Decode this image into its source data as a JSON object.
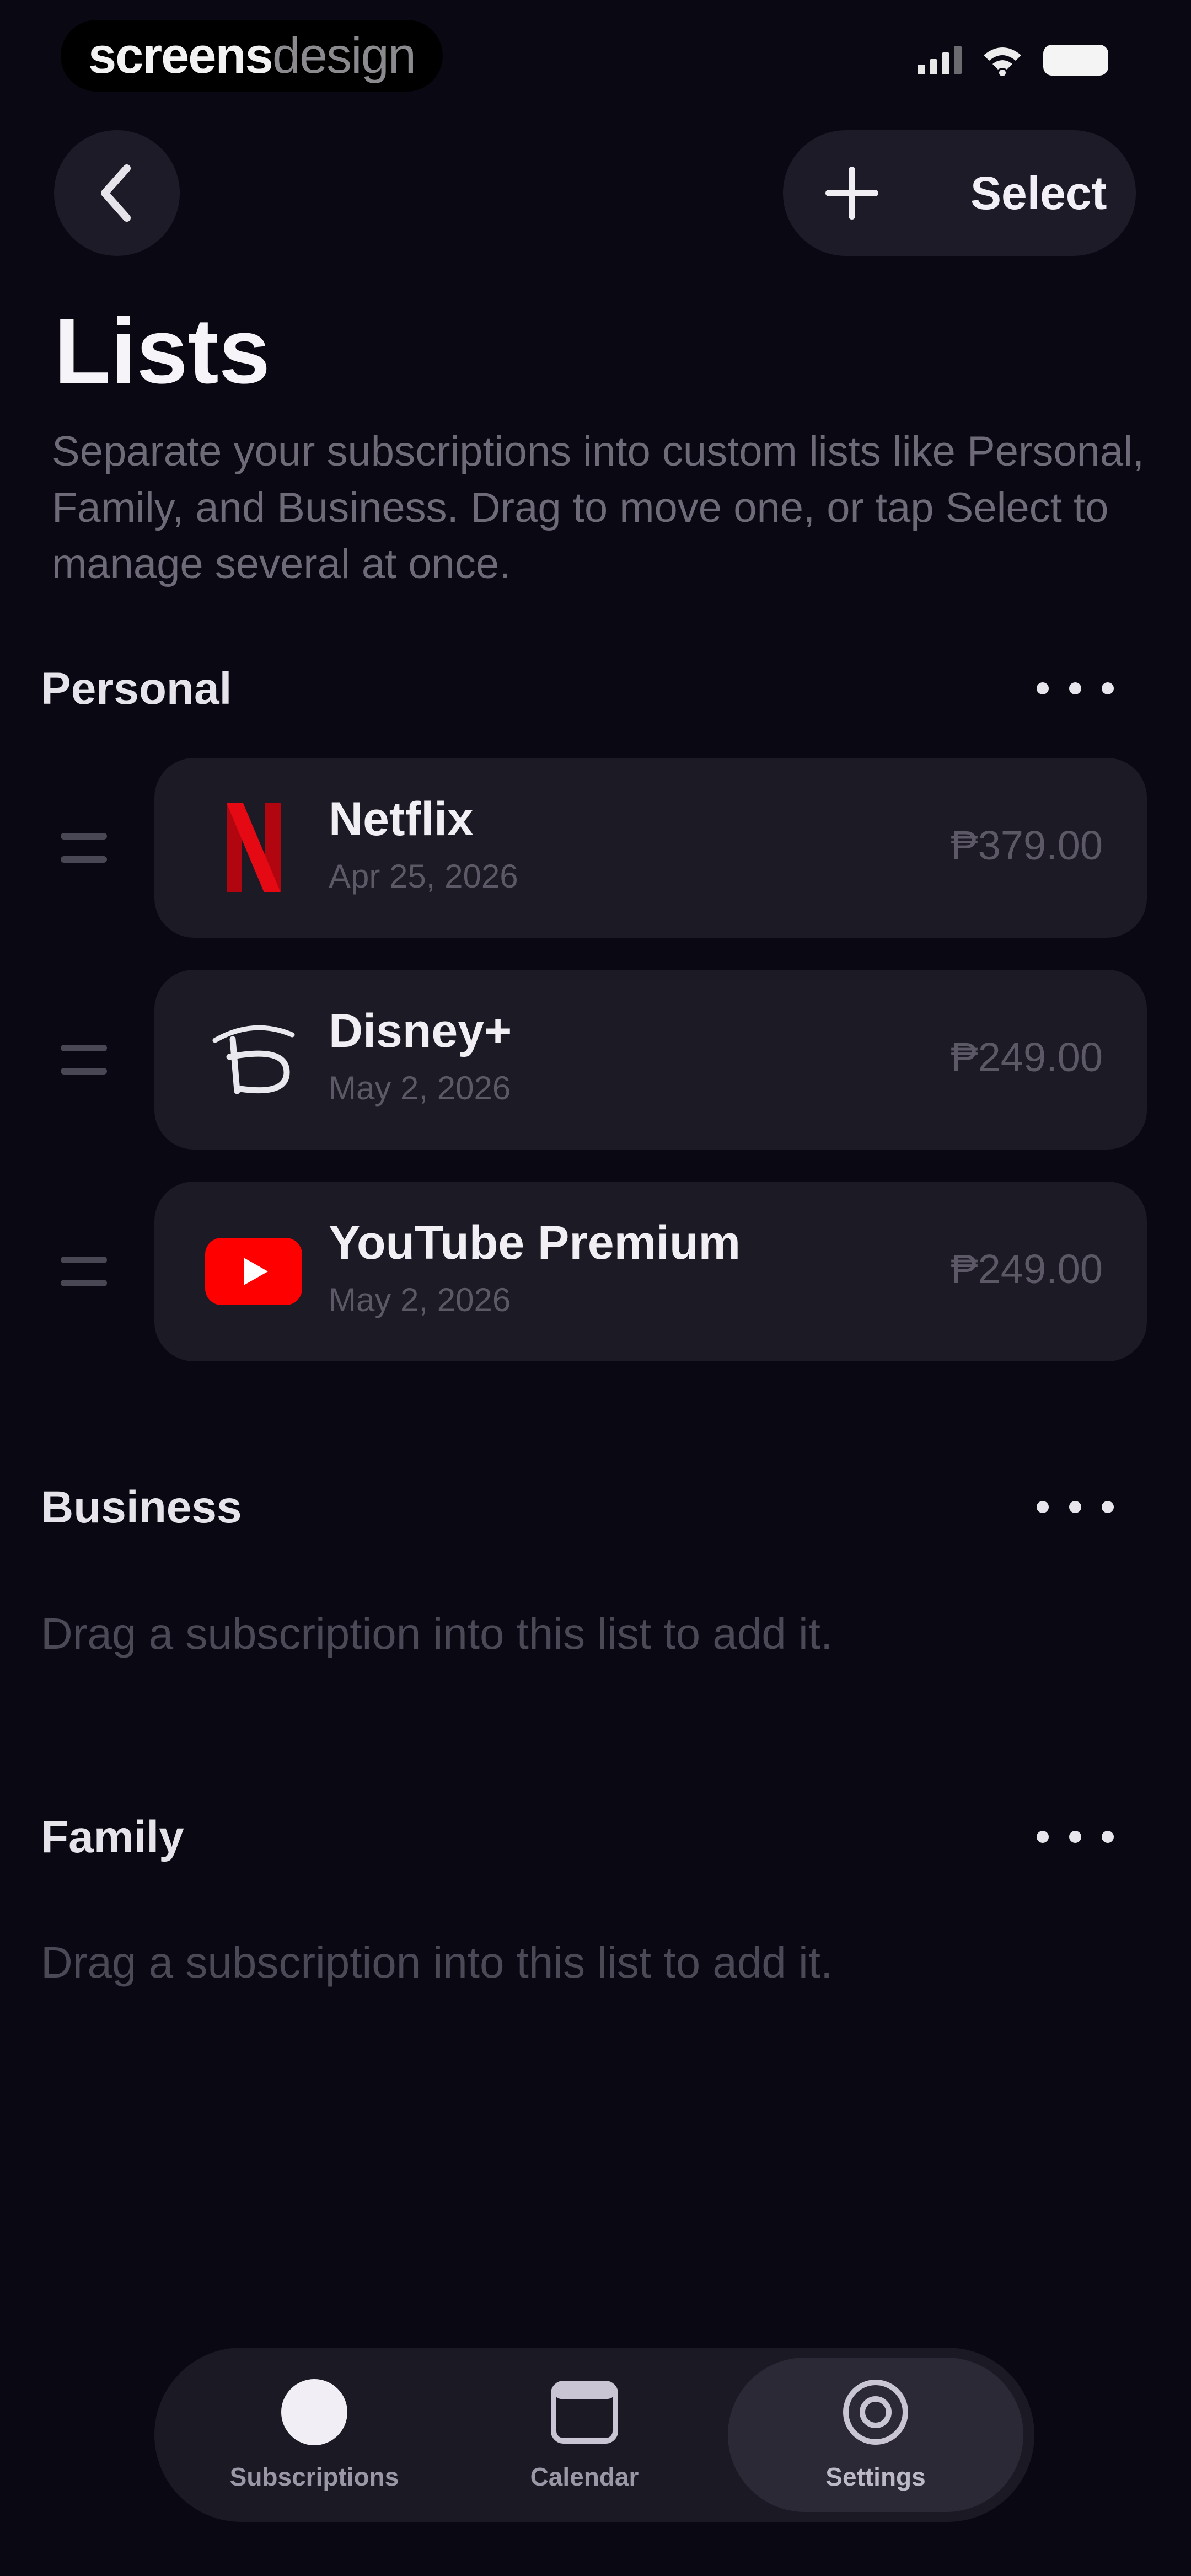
{
  "status_bar": {
    "watermark_part1": "screens",
    "watermark_part2": "design",
    "icons": [
      "cellular-signal-icon",
      "wifi-icon",
      "battery-icon"
    ]
  },
  "header": {
    "back_icon": "chevron-left-icon",
    "add_icon": "plus-icon",
    "select_label": "Select"
  },
  "page": {
    "title": "Lists",
    "description": "Separate your subscriptions into custom lists like Personal, Family, and Business. Drag to move one, or tap Select to manage several at once."
  },
  "lists": [
    {
      "label": "Personal",
      "items": [
        {
          "name": "Netflix",
          "date": "Apr 25, 2026",
          "price": "₱379.00",
          "icon": "netflix-logo"
        },
        {
          "name": "Disney+",
          "date": "May 2, 2026",
          "price": "₱249.00",
          "icon": "disney-plus-logo"
        },
        {
          "name": "YouTube Premium",
          "date": "May 2, 2026",
          "price": "₱249.00",
          "icon": "youtube-logo"
        }
      ]
    },
    {
      "label": "Business",
      "empty_message": "Drag a subscription into this list to add it."
    },
    {
      "label": "Family",
      "empty_message": "Drag a subscription into this list to add it."
    }
  ],
  "tabbar": {
    "tabs": [
      {
        "label": "Subscriptions",
        "icon": "circle-icon",
        "active": false
      },
      {
        "label": "Calendar",
        "icon": "calendar-icon",
        "active": false
      },
      {
        "label": "Settings",
        "icon": "settings-icon",
        "active": true
      }
    ]
  },
  "colors": {
    "background": "#0a0813",
    "card": "#1c1a24",
    "netflix_red": "#e50914",
    "youtube_red": "#ff0000"
  }
}
